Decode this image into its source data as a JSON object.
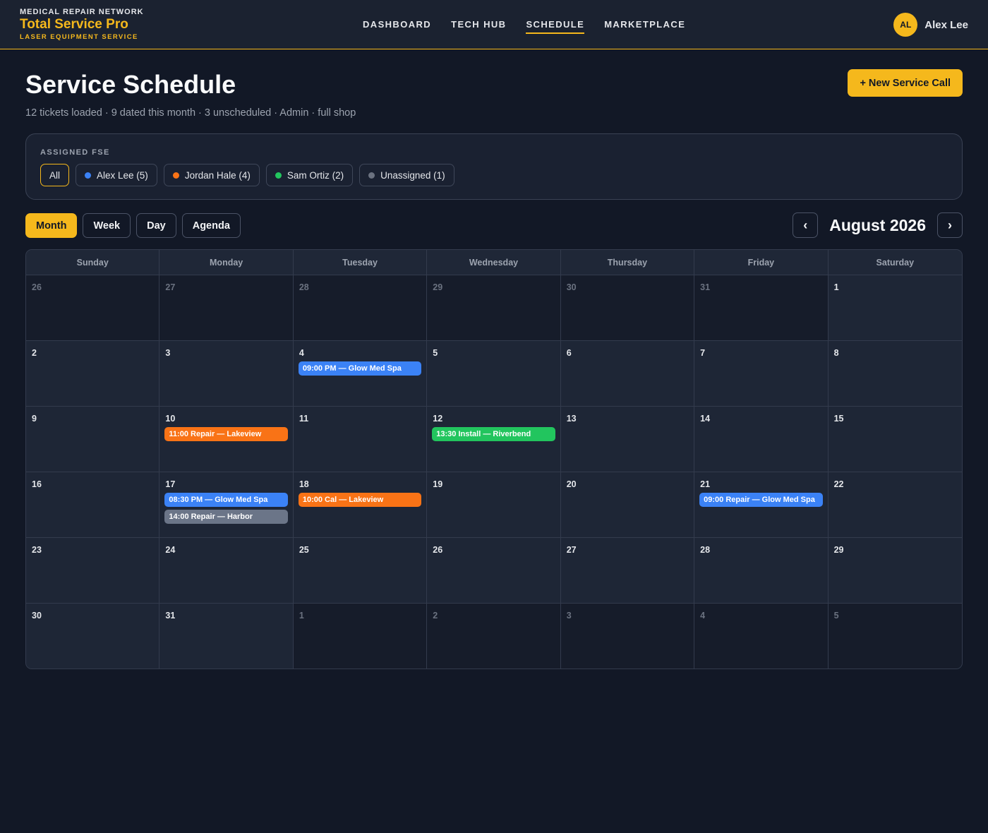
{
  "brand": {
    "network": "MEDICAL REPAIR NETWORK",
    "name": "Total Service Pro",
    "tagline": "LASER EQUIPMENT SERVICE"
  },
  "nav": [
    {
      "label": "DASHBOARD",
      "active": false
    },
    {
      "label": "TECH HUB",
      "active": false
    },
    {
      "label": "SCHEDULE",
      "active": true
    },
    {
      "label": "MARKETPLACE",
      "active": false
    }
  ],
  "user": {
    "initials": "AL",
    "name": "Alex Lee"
  },
  "header": {
    "title": "Service Schedule",
    "subtitle": "12 tickets loaded · 9 dated this month · 3 unscheduled · Admin · full shop",
    "new_call_label": "+ New Service Call"
  },
  "filter": {
    "label": "ASSIGNED FSE",
    "chips": [
      {
        "label": "All",
        "color": null,
        "active": true
      },
      {
        "label": "Alex Lee (5)",
        "color": "#3b82f6",
        "active": false
      },
      {
        "label": "Jordan Hale (4)",
        "color": "#f97316",
        "active": false
      },
      {
        "label": "Sam Ortiz (2)",
        "color": "#22c55e",
        "active": false
      },
      {
        "label": "Unassigned (1)",
        "color": "#6b7280",
        "active": false
      }
    ]
  },
  "views": [
    {
      "label": "Month",
      "active": true
    },
    {
      "label": "Week",
      "active": false
    },
    {
      "label": "Day",
      "active": false
    },
    {
      "label": "Agenda",
      "active": false
    }
  ],
  "month_nav": {
    "prev_icon": "chevron-left-icon",
    "next_icon": "chevron-right-icon",
    "label": "August 2026"
  },
  "calendar": {
    "weekdays": [
      "Sunday",
      "Monday",
      "Tuesday",
      "Wednesday",
      "Thursday",
      "Friday",
      "Saturday"
    ],
    "weeks": [
      [
        {
          "day": "26",
          "outside": true,
          "events": []
        },
        {
          "day": "27",
          "outside": true,
          "events": []
        },
        {
          "day": "28",
          "outside": true,
          "events": []
        },
        {
          "day": "29",
          "outside": true,
          "events": []
        },
        {
          "day": "30",
          "outside": true,
          "events": []
        },
        {
          "day": "31",
          "outside": true,
          "events": []
        },
        {
          "day": "1",
          "outside": false,
          "events": []
        }
      ],
      [
        {
          "day": "2",
          "outside": false,
          "events": []
        },
        {
          "day": "3",
          "outside": false,
          "events": []
        },
        {
          "day": "4",
          "outside": false,
          "events": [
            {
              "label": "09:00 PM — Glow Med Spa",
              "color": "#3b82f6"
            }
          ]
        },
        {
          "day": "5",
          "outside": false,
          "events": []
        },
        {
          "day": "6",
          "outside": false,
          "events": []
        },
        {
          "day": "7",
          "outside": false,
          "events": []
        },
        {
          "day": "8",
          "outside": false,
          "events": []
        }
      ],
      [
        {
          "day": "9",
          "outside": false,
          "events": []
        },
        {
          "day": "10",
          "outside": false,
          "events": [
            {
              "label": "11:00 Repair — Lakeview",
              "color": "#f97316"
            }
          ]
        },
        {
          "day": "11",
          "outside": false,
          "events": []
        },
        {
          "day": "12",
          "outside": false,
          "events": [
            {
              "label": "13:30 Install — Riverbend",
              "color": "#22c55e"
            }
          ]
        },
        {
          "day": "13",
          "outside": false,
          "events": []
        },
        {
          "day": "14",
          "outside": false,
          "events": []
        },
        {
          "day": "15",
          "outside": false,
          "events": []
        }
      ],
      [
        {
          "day": "16",
          "outside": false,
          "events": []
        },
        {
          "day": "17",
          "outside": false,
          "events": [
            {
              "label": "08:30 PM — Glow Med Spa",
              "color": "#3b82f6"
            },
            {
              "label": "14:00 Repair — Harbor",
              "color": "#6b7588"
            }
          ]
        },
        {
          "day": "18",
          "outside": false,
          "events": [
            {
              "label": "10:00 Cal — Lakeview",
              "color": "#f97316"
            }
          ]
        },
        {
          "day": "19",
          "outside": false,
          "events": []
        },
        {
          "day": "20",
          "outside": false,
          "events": []
        },
        {
          "day": "21",
          "outside": false,
          "events": [
            {
              "label": "09:00 Repair — Glow Med Spa",
              "color": "#3b82f6"
            }
          ]
        },
        {
          "day": "22",
          "outside": false,
          "events": []
        }
      ],
      [
        {
          "day": "23",
          "outside": false,
          "events": []
        },
        {
          "day": "24",
          "outside": false,
          "events": []
        },
        {
          "day": "25",
          "outside": false,
          "events": []
        },
        {
          "day": "26",
          "outside": false,
          "events": []
        },
        {
          "day": "27",
          "outside": false,
          "events": []
        },
        {
          "day": "28",
          "outside": false,
          "events": []
        },
        {
          "day": "29",
          "outside": false,
          "events": []
        }
      ],
      [
        {
          "day": "30",
          "outside": false,
          "events": []
        },
        {
          "day": "31",
          "outside": false,
          "events": []
        },
        {
          "day": "1",
          "outside": true,
          "events": []
        },
        {
          "day": "2",
          "outside": true,
          "events": []
        },
        {
          "day": "3",
          "outside": true,
          "events": []
        },
        {
          "day": "4",
          "outside": true,
          "events": []
        },
        {
          "day": "5",
          "outside": true,
          "events": []
        }
      ]
    ]
  },
  "colors": {
    "accent": "#f5b81c",
    "background": "#121826",
    "panel": "#1a2131"
  }
}
